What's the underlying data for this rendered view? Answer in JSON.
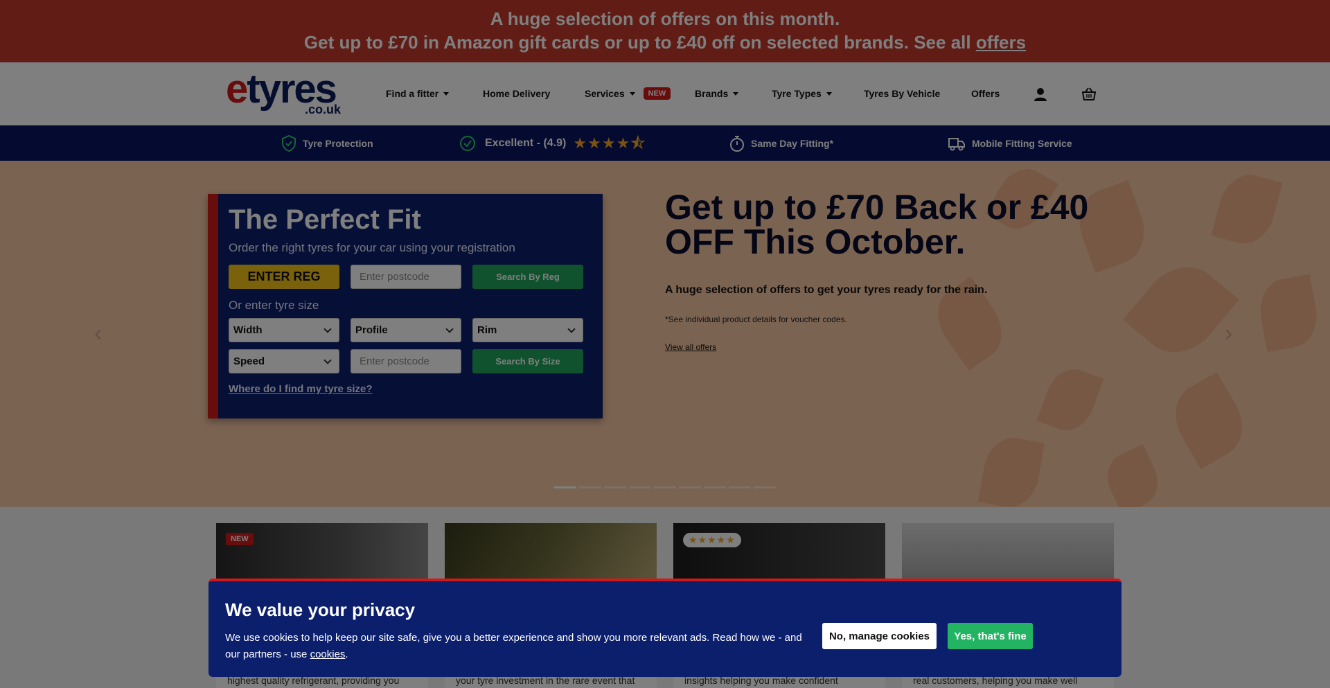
{
  "promo": {
    "line1": "A huge selection of offers on this month.",
    "line2_prefix": "Get up to £70 in Amazon gift cards or up to £40 off on selected brands. See all ",
    "line2_link": "offers"
  },
  "header": {
    "logo_word_e": "e",
    "logo_word_rest": "tyres",
    "logo_tld": ".co.uk",
    "nav": {
      "find_fitter": "Find a fitter",
      "home_delivery": "Home Delivery",
      "services": "Services",
      "services_badge": "NEW",
      "brands": "Brands",
      "tyre_types": "Tyre Types",
      "tyres_by_vehicle": "Tyres By Vehicle",
      "offers": "Offers"
    },
    "icons": [
      "account-icon",
      "basket-icon"
    ]
  },
  "trust_bar": {
    "protection": "Tyre Protection",
    "rating_text": "Excellent - (4.9)",
    "rating_stars": 4.5,
    "same_day": "Same Day Fitting*",
    "mobile": "Mobile Fitting Service"
  },
  "finder": {
    "title": "The Perfect Fit",
    "subtitle": "Order the right tyres for your car using your registration",
    "reg_placeholder": "ENTER REG",
    "postcode_placeholder": "Enter postcode",
    "search_by_reg": "Search By Reg",
    "size_label": "Or enter tyre size",
    "width": "Width",
    "profile": "Profile",
    "rim": "Rim",
    "speed": "Speed",
    "postcode_placeholder_2": "Enter postcode",
    "search_by_size": "Search By Size",
    "help_link": "Where do I find my tyre size?"
  },
  "hero": {
    "headline": "Get up to £70 Back or £40 OFF This October.",
    "description": "A huge selection of offers to get your tyres ready for the rain.",
    "note": "*See individual product details for voucher codes.",
    "link": "View all offers",
    "slides_count": 9,
    "active_slide": 0
  },
  "cards": [
    {
      "badge": "NEW",
      "text": "highest quality refrigerant, providing you"
    },
    {
      "badge": "",
      "text": "your tyre investment in the rare event that"
    },
    {
      "badge": "",
      "stars": "★★★★★",
      "text": "insights helping you make confident"
    },
    {
      "badge": "",
      "text": "real customers, helping you make well"
    }
  ],
  "cookie": {
    "title": "We value your privacy",
    "body_prefix": "We use cookies to help keep our site safe, give you a better experience and show you more relevant ads. Read how we - and our partners - use ",
    "body_link": "cookies",
    "body_suffix": ".",
    "manage_button": "No, manage cookies",
    "accept_button": "Yes, that's fine"
  },
  "colors": {
    "brand_red": "#d11919",
    "brand_navy": "#0c1f6d",
    "accent_green": "#22b462",
    "reg_yellow": "#f5c518"
  }
}
